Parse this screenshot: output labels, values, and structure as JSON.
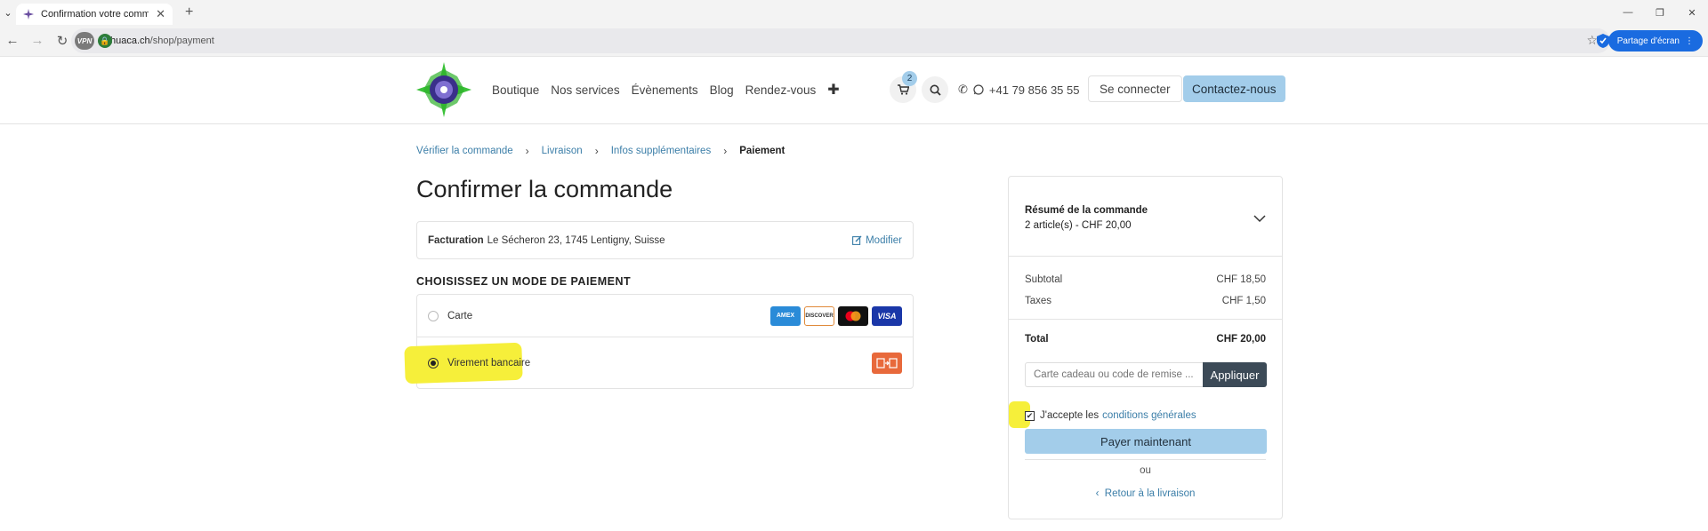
{
  "browser": {
    "tab_title": "Confirmation votre commande",
    "url_host": "huaca.ch",
    "url_path": "/shop/payment",
    "vpn_label": "VPN",
    "share_label": "Partage d'écran"
  },
  "header": {
    "menu": [
      "Boutique",
      "Nos services",
      "Évènements",
      "Blog",
      "Rendez-vous"
    ],
    "cart_count": "2",
    "phone": "+41 79 856 35 55",
    "login_label": "Se connecter",
    "contact_label": "Contactez-nous"
  },
  "breadcrumb": {
    "items": [
      "Vérifier la commande",
      "Livraison",
      "Infos supplémentaires"
    ],
    "current": "Paiement"
  },
  "page": {
    "title": "Confirmer la commande",
    "billing_label": "Facturation",
    "billing_address": "Le Sécheron 23, 1745 Lentigny, Suisse",
    "edit_label": "Modifier",
    "payment_title": "CHOISISSEZ UN MODE DE PAIEMENT",
    "methods": [
      {
        "label": "Carte",
        "selected": false
      },
      {
        "label": "Virement bancaire",
        "selected": true
      }
    ],
    "card_brands": [
      "AMEX",
      "DISCOVER",
      "mastercard",
      "VISA"
    ]
  },
  "summary": {
    "title": "Résumé de la commande",
    "subtitle": "2 article(s) -  CHF 20,00",
    "subtotal_label": "Subtotal",
    "subtotal_value": "CHF 18,50",
    "taxes_label": "Taxes",
    "taxes_value": "CHF 1,50",
    "total_label": "Total",
    "total_value": "CHF 20,00",
    "coupon_placeholder": "Carte cadeau ou code de remise ...",
    "apply_label": "Appliquer",
    "terms_prefix": "J'accepte les",
    "terms_link": "conditions générales",
    "terms_checked": true,
    "pay_label": "Payer maintenant",
    "or_label": "ou",
    "back_label": "Retour à la livraison"
  },
  "colors": {
    "accent": "#a3cdea",
    "link": "#3b7ea8",
    "highlight": "#f6ef3a",
    "apply_bg": "#3c4a57"
  }
}
